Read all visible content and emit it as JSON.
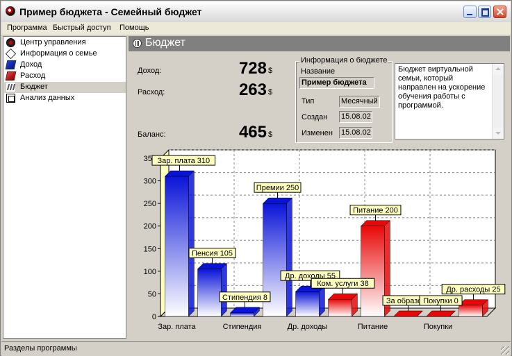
{
  "window": {
    "title": "Пример бюджета - Семейный бюджет"
  },
  "menu": [
    "Программа",
    "Быстрый доступ",
    "Помощь"
  ],
  "sidebar": {
    "items": [
      {
        "label": "Центр управления",
        "icon": "control-center-icon"
      },
      {
        "label": "Информация о семье",
        "icon": "family-info-icon"
      },
      {
        "label": "Доход",
        "icon": "income-icon"
      },
      {
        "label": "Расход",
        "icon": "expense-icon"
      },
      {
        "label": "Бюджет",
        "icon": "budget-icon",
        "selected": true
      },
      {
        "label": "Анализ данных",
        "icon": "data-analysis-icon"
      }
    ]
  },
  "header": {
    "title": "Бюджет",
    "icon": "budget-icon"
  },
  "stats": {
    "income_label": "Доход:",
    "income_value": "728",
    "expense_label": "Расход:",
    "expense_value": "263",
    "balance_label": "Баланс:",
    "balance_value": "465",
    "currency": "$"
  },
  "budget_info": {
    "group_title": "Информация о бюджете",
    "name_label": "Название",
    "name_value": "Пример бюджета",
    "type_label": "Тип",
    "type_value": "Месячный",
    "created_label": "Создан",
    "created_value": "15.08.02",
    "modified_label": "Изменен",
    "modified_value": "15.08.02"
  },
  "description": "Бюджет виртуальной семьи, который направлен на ускорение обучения работы с программой.",
  "chart_data": {
    "type": "bar",
    "ylim": [
      0,
      350
    ],
    "yticks": [
      0,
      50,
      100,
      150,
      200,
      250,
      300,
      350
    ],
    "categories": [
      "Зар. плата",
      "Пенсия",
      "Стипендия",
      "Премии",
      "Др. доходы",
      "Ком. услуги",
      "Питание",
      "За образ",
      "Покупки",
      "Др. расходы"
    ],
    "xtick_labels": [
      "Зар. плата",
      "Стипендия",
      "Др. доходы",
      "Питание",
      "Покупки"
    ],
    "xtick_indices": [
      0,
      2,
      4,
      6,
      8
    ],
    "values": [
      310,
      105,
      8,
      250,
      55,
      38,
      200,
      0,
      0,
      25
    ],
    "kinds": [
      "income",
      "income",
      "income",
      "income",
      "income",
      "expense",
      "expense",
      "expense",
      "expense",
      "expense"
    ],
    "data_labels": [
      "Зар. плата 310",
      "Пенсия 105",
      "Стипендия 8",
      "Премии 250",
      "Др. доходы 55",
      "Ком. услуги 38",
      "Питание 200",
      "За образова",
      "Покупки 0",
      "Др. расходы 25"
    ],
    "grid": true,
    "colors": {
      "income": "#0a14d8",
      "expense": "#e80808",
      "label_bg": "#ffffc0",
      "axis_wall": "#ffffc0"
    }
  },
  "status": {
    "text": "Разделы программы"
  }
}
